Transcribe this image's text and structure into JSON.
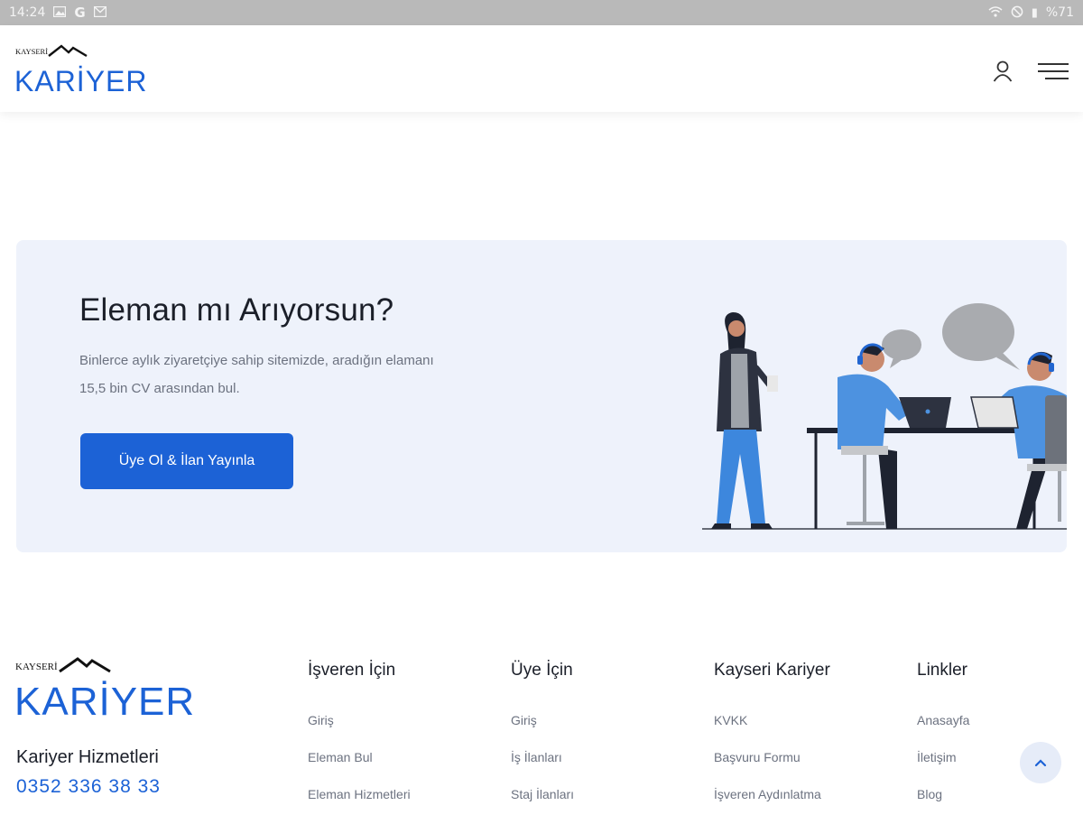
{
  "status_bar": {
    "time": "14:24",
    "battery": "%71",
    "left_icons": [
      "gallery-icon",
      "google-icon",
      "gmail-icon"
    ],
    "right_icons": [
      "wifi-icon",
      "do-not-disturb-icon",
      "battery-icon"
    ]
  },
  "brand": {
    "logo_top": "KAYSERİ",
    "logo_main": "KARİYER",
    "accent": "#1c62d6"
  },
  "header": {
    "icons": [
      "user-icon",
      "hamburger-menu-icon"
    ]
  },
  "cta": {
    "title": "Eleman mı Arıyorsun?",
    "text_line1": "Binlerce aylık ziyaretçiye sahip sitemizde, aradığın elamanı",
    "text_line2": "15,5 bin CV arasından bul.",
    "button_label": "Üye Ol & İlan Yayınla",
    "background": "#eef2fb"
  },
  "footer": {
    "title": "Kariyer Hizmetleri",
    "phone": "0352 336 38 33",
    "columns": [
      {
        "heading": "İşveren İçin",
        "links": [
          "Giriş",
          "Eleman Bul",
          "Eleman Hizmetleri"
        ]
      },
      {
        "heading": "Üye İçin",
        "links": [
          "Giriş",
          "İş İlanları",
          "Staj İlanları"
        ]
      },
      {
        "heading": "Kayseri Kariyer",
        "links": [
          "KVKK",
          "Başvuru Formu",
          "İşveren Aydınlatma"
        ]
      },
      {
        "heading": "Linkler",
        "links": [
          "Anasayfa",
          "İletişim",
          "Blog"
        ]
      }
    ]
  },
  "scroll_top_icon": "chevron-up-icon"
}
